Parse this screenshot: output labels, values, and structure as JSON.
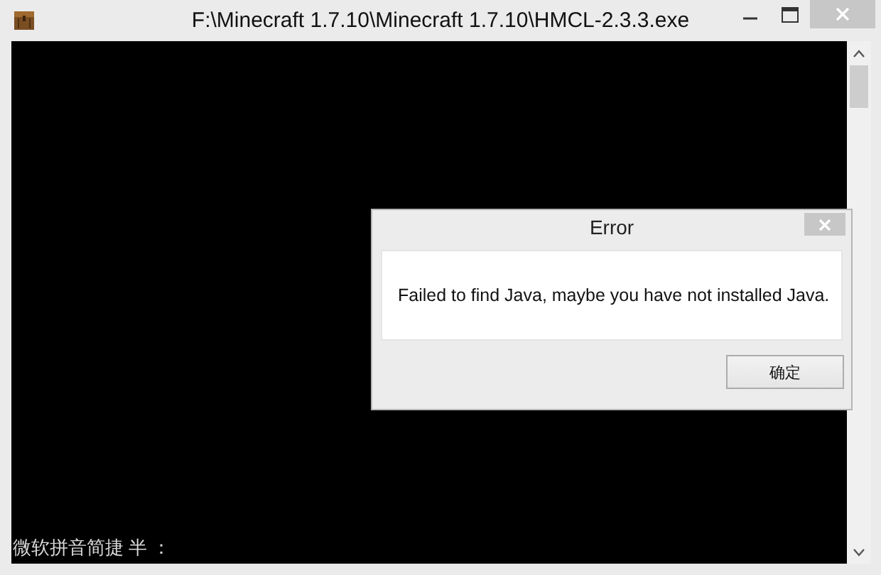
{
  "window": {
    "title": "F:\\Minecraft 1.7.10\\Minecraft 1.7.10\\HMCL-2.3.3.exe"
  },
  "console": {
    "ime_status": "微软拼音简捷 半 ："
  },
  "dialog": {
    "title": "Error",
    "message": "Failed to find Java, maybe you have not installed Java.",
    "buttons": [
      "确定"
    ]
  }
}
